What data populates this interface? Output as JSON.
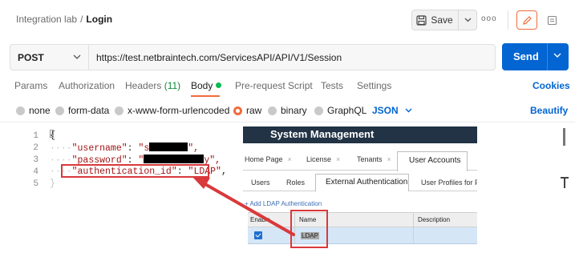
{
  "header": {
    "collection": "Integration lab",
    "separator": "/",
    "request_name": "Login",
    "save_label": "Save",
    "more_label": "ooo"
  },
  "request": {
    "method": "POST",
    "url": "https://test.netbraintech.com/ServicesAPI/API/V1/Session",
    "send_label": "Send"
  },
  "tabs": {
    "params": "Params",
    "authorization": "Authorization",
    "headers": "Headers",
    "headers_count": "(11)",
    "body": "Body",
    "prerequest": "Pre-request Script",
    "tests": "Tests",
    "settings": "Settings",
    "cookies": "Cookies"
  },
  "body_types": {
    "none": "none",
    "form_data": "form-data",
    "urlencoded": "x-www-form-urlencoded",
    "raw": "raw",
    "binary": "binary",
    "graphql": "GraphQL",
    "format": "JSON",
    "beautify": "Beautify"
  },
  "editor": {
    "line_numbers": [
      "1",
      "2",
      "3",
      "4",
      "5"
    ],
    "open_brace": "{",
    "username_key": "\"username\"",
    "username_value_prefix": "\"s",
    "username_value_suffix": "\",",
    "password_key": "\"password\"",
    "password_value_prefix": "\"",
    "password_value_suffix": "y\",",
    "auth_key": "\"authentication_id\"",
    "auth_value": "\"LDAP\"",
    "auth_suffix": ",",
    "colon": ": "
  },
  "embedded": {
    "title": "System Management",
    "tabs": [
      "Home Page",
      "License",
      "Tenants"
    ],
    "active_tab": "User Accounts",
    "subtabs": [
      "Users",
      "Roles"
    ],
    "active_subtab": "External Authentication",
    "trailing_subtab": "User Profiles for Pc",
    "add_link": "+ Add LDAP Authentication",
    "columns": [
      "Enable",
      "Name",
      "Description"
    ],
    "row_name": "LDAP"
  },
  "colors": {
    "accent_orange": "#f26b3a",
    "send_blue": "#0265d2",
    "highlight_red": "#d9393b",
    "embedded_header": "#213345"
  }
}
